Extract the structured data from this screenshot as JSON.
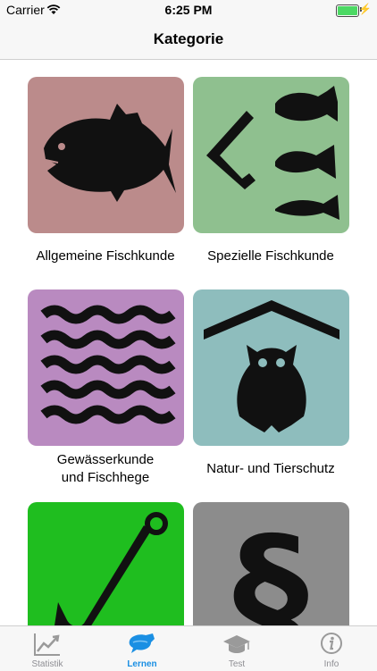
{
  "status": {
    "carrier": "Carrier",
    "time": "6:25 PM"
  },
  "nav": {
    "title": "Kategorie"
  },
  "categories": [
    {
      "label": "Allgemeine Fischkunde",
      "color": "#bb8b8b",
      "icon": "fish-icon"
    },
    {
      "label": "Spezielle Fischkunde",
      "color": "#8fc08f",
      "icon": "fish-species-icon"
    },
    {
      "label": "Gewässerkunde\nund Fischhege",
      "color": "#b98ac0",
      "icon": "waves-icon"
    },
    {
      "label": "Natur- und Tierschutz",
      "color": "#8ebdbd",
      "icon": "owl-icon"
    },
    {
      "label": "",
      "color": "#1fbe1f",
      "icon": "hook-icon"
    },
    {
      "label": "",
      "color": "#8c8c8c",
      "icon": "paragraph-icon"
    }
  ],
  "tabs": [
    {
      "label": "Statistik",
      "icon": "chart-icon"
    },
    {
      "label": "Lernen",
      "icon": "learn-icon"
    },
    {
      "label": "Test",
      "icon": "graduation-cap-icon"
    },
    {
      "label": "Info",
      "icon": "info-icon"
    }
  ],
  "accent": "#1a8fe3"
}
